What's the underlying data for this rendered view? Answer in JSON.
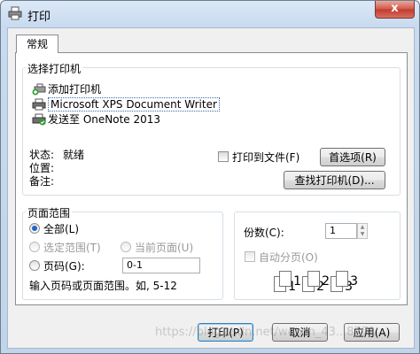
{
  "window": {
    "title": "打印",
    "close_glyph": "x"
  },
  "tabs": [
    {
      "label": "常规"
    }
  ],
  "select_printer": {
    "title": "选择打印机",
    "printers": [
      {
        "label": "添加打印机",
        "icon": "add-printer-icon"
      },
      {
        "label": "Microsoft XPS Document Writer",
        "icon": "printer-icon",
        "selected": true
      },
      {
        "label": "发送至 OneNote 2013",
        "icon": "printer-default-icon"
      }
    ],
    "status_label": "状态:",
    "status_value": "就绪",
    "location_label": "位置:",
    "comment_label": "备注:",
    "print_to_file_label": "打印到文件(F)",
    "preferences_button": "首选项(R)",
    "find_printer_button": "查找打印机(D)..."
  },
  "page_range": {
    "title": "页面范围",
    "all_label": "全部(L)",
    "selection_label": "选定范围(T)",
    "current_page_label": "当前页面(U)",
    "pages_label": "页码(G):",
    "pages_value": "0-1",
    "hint": "输入页码或页面范围。如, 5-12"
  },
  "copies": {
    "label": "份数(C):",
    "value": "1",
    "collate_label": "自动分页(O)",
    "collate_pages": [
      "1",
      "1",
      "2",
      "2",
      "3",
      "3"
    ]
  },
  "footer": {
    "print_button": "打印(P)",
    "cancel_button": "取消",
    "apply_button": "应用(A)",
    "watermark": "https://blog.csdn.net/weixin_43...8771"
  }
}
